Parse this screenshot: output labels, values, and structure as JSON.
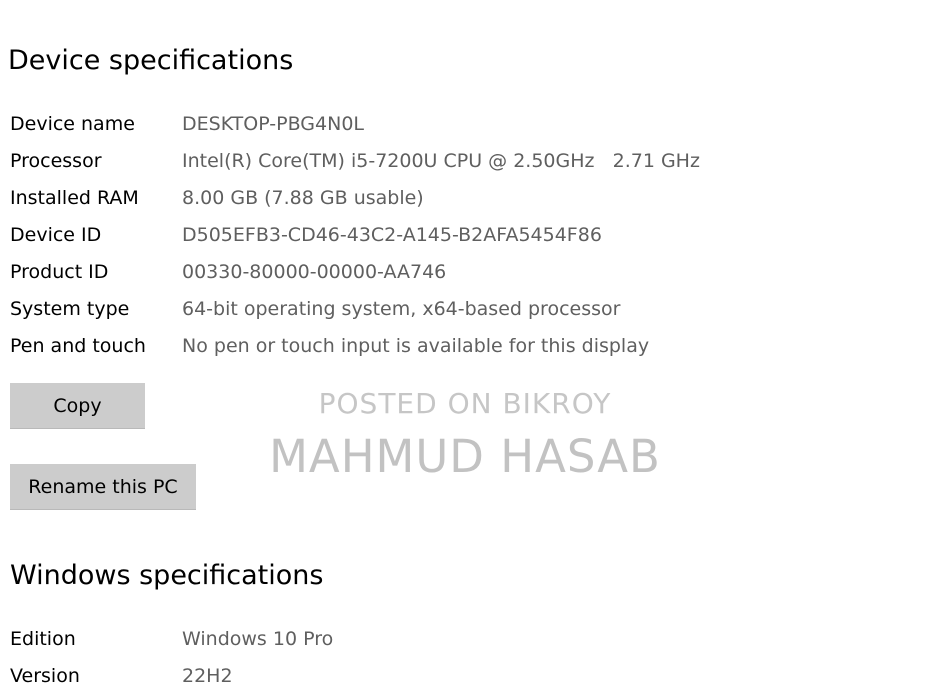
{
  "device_specs": {
    "title": "Device specifications",
    "rows": [
      {
        "label": "Device name",
        "value": "DESKTOP-PBG4N0L"
      },
      {
        "label": "Processor",
        "value": "Intel(R) Core(TM) i5-7200U CPU @ 2.50GHz   2.71 GHz"
      },
      {
        "label": "Installed RAM",
        "value": "8.00 GB (7.88 GB usable)"
      },
      {
        "label": "Device ID",
        "value": "D505EFB3-CD46-43C2-A145-B2AFA5454F86"
      },
      {
        "label": "Product ID",
        "value": "00330-80000-00000-AA746"
      },
      {
        "label": "System type",
        "value": "64-bit operating system, x64-based processor"
      },
      {
        "label": "Pen and touch",
        "value": "No pen or touch input is available for this display"
      }
    ],
    "copy_button": "Copy",
    "rename_button": "Rename this PC"
  },
  "watermark": {
    "line1": "POSTED ON BIKROY",
    "line2": "MAHMUD HASAB"
  },
  "windows_specs": {
    "title": "Windows specifications",
    "rows": [
      {
        "label": "Edition",
        "value": "Windows 10 Pro"
      },
      {
        "label": "Version",
        "value": "22H2"
      }
    ]
  }
}
